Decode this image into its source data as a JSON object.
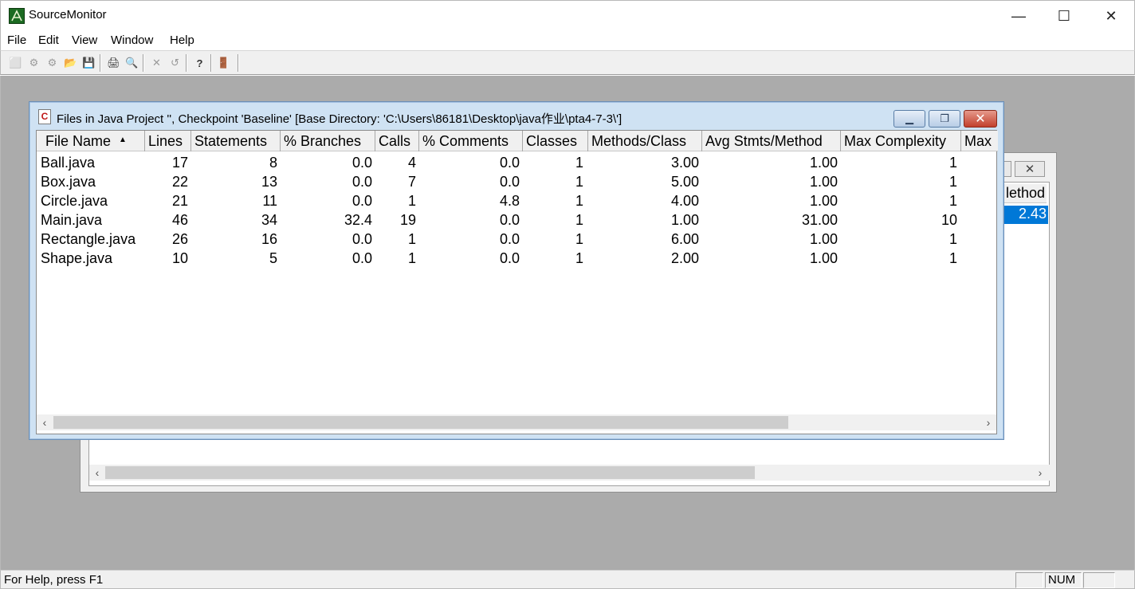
{
  "app": {
    "title": "SourceMonitor"
  },
  "window_buttons": {
    "minimize": "—",
    "maximize": "☐",
    "close": "✕"
  },
  "menu": [
    "File",
    "Edit",
    "View",
    "Window",
    "Help"
  ],
  "toolbar": {
    "buttons": [
      {
        "icon": "new-file-icon",
        "glyph": "⬜"
      },
      {
        "icon": "gear-icon",
        "glyph": "⚙"
      },
      {
        "icon": "multi-gear-icon",
        "glyph": "⚙"
      },
      {
        "icon": "open-folder-icon",
        "glyph": "📂"
      },
      {
        "icon": "save-icon",
        "glyph": "💾"
      },
      {
        "icon": "print-icon",
        "glyph": "🖨"
      },
      {
        "icon": "print-preview-icon",
        "glyph": "🔍"
      },
      {
        "icon": "delete-icon",
        "glyph": "✕"
      },
      {
        "icon": "undo-icon",
        "glyph": "↺"
      },
      {
        "icon": "context-help-icon",
        "glyph": "?"
      },
      {
        "icon": "exit-door-icon",
        "glyph": "🚪"
      }
    ]
  },
  "front_window": {
    "title": "Files in Java Project '', Checkpoint 'Baseline'  [Base Directory: 'C:\\Users\\86181\\Desktop\\java作业\\pta4-7-3\\']",
    "icon_text": "C",
    "columns": [
      "File Name",
      "Lines",
      "Statements",
      "% Branches",
      "Calls",
      "% Comments",
      "Classes",
      "Methods/Class",
      "Avg Stmts/Method",
      "Max Complexity",
      "Max"
    ],
    "rows": [
      [
        "Ball.java",
        "17",
        "8",
        "0.0",
        "4",
        "0.0",
        "1",
        "3.00",
        "1.00",
        "1"
      ],
      [
        "Box.java",
        "22",
        "13",
        "0.0",
        "7",
        "0.0",
        "1",
        "5.00",
        "1.00",
        "1"
      ],
      [
        "Circle.java",
        "21",
        "11",
        "0.0",
        "1",
        "4.8",
        "1",
        "4.00",
        "1.00",
        "1"
      ],
      [
        "Main.java",
        "46",
        "34",
        "32.4",
        "19",
        "0.0",
        "1",
        "1.00",
        "31.00",
        "10"
      ],
      [
        "Rectangle.java",
        "26",
        "16",
        "0.0",
        "1",
        "0.0",
        "1",
        "6.00",
        "1.00",
        "1"
      ],
      [
        "Shape.java",
        "10",
        "5",
        "0.0",
        "1",
        "0.0",
        "1",
        "2.00",
        "1.00",
        "1"
      ]
    ]
  },
  "back_window": {
    "header_fragment": "lethod",
    "selected_value": "2.43"
  },
  "statusbar": {
    "help_text": "For Help, press F1",
    "num_indicator": "NUM"
  }
}
